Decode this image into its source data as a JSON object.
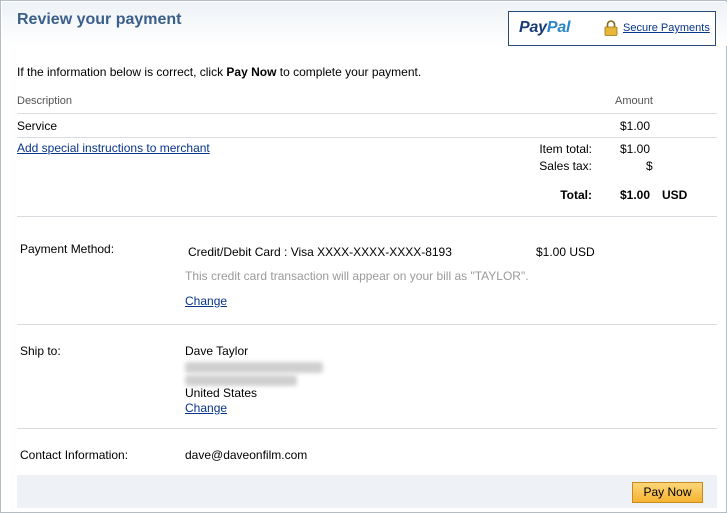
{
  "header": {
    "title": "Review your payment",
    "brand_pay": "Pay",
    "brand_pal": "Pal",
    "secure_link": "Secure Payments",
    "icons": {
      "lock": "lock-icon"
    }
  },
  "intro": {
    "before": "If the information below is correct, click ",
    "bold": "Pay Now",
    "after": " to complete your payment."
  },
  "table": {
    "col_description": "Description",
    "col_amount": "Amount",
    "item": {
      "description": "Service",
      "amount": "$1.00"
    },
    "instructions_link": "Add special instructions to merchant",
    "item_total_label": "Item total:",
    "item_total_value": "$1.00",
    "sales_tax_label": "Sales tax:",
    "sales_tax_value": "$",
    "total_label": "Total:",
    "total_value": "$1.00",
    "total_currency": "USD"
  },
  "payment_method": {
    "label": "Payment Method:",
    "card": "Credit/Debit Card : Visa XXXX-XXXX-XXXX-8193",
    "amount": "$1.00 USD",
    "note": "This credit card transaction will appear on your bill as \"TAYLOR\".",
    "change": "Change"
  },
  "ship_to": {
    "label": "Ship to:",
    "name": "Dave Taylor",
    "country": "United States",
    "change": "Change"
  },
  "contact": {
    "label": "Contact Information:",
    "email": "dave@daveonfilm.com"
  },
  "actions": {
    "pay_now": "Pay Now"
  },
  "colors": {
    "title": "#3a5f8a",
    "link": "#08348a",
    "button": "#f5b332"
  }
}
